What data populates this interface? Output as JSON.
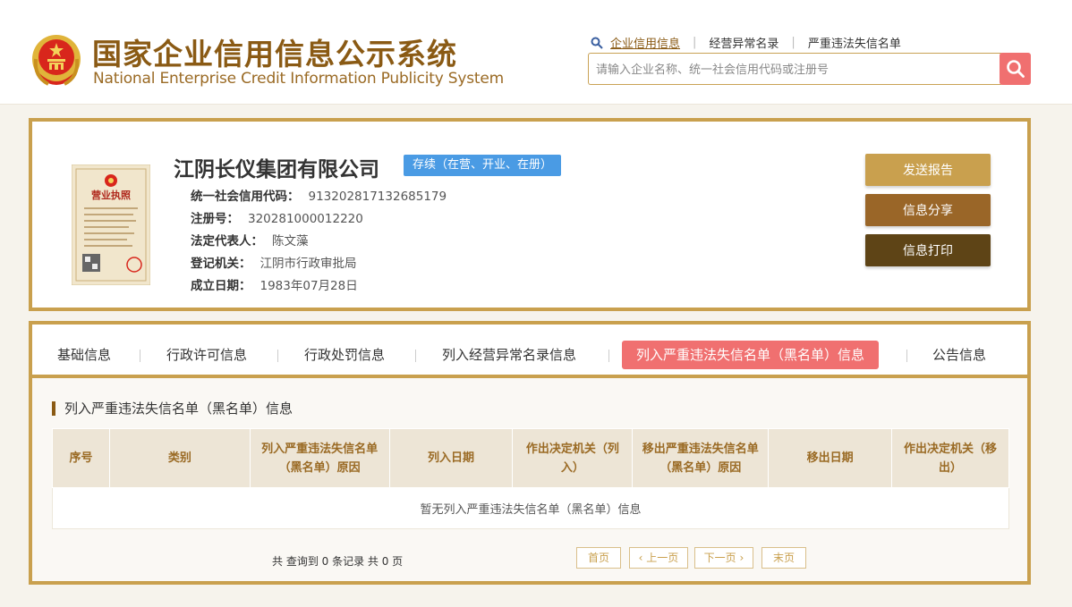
{
  "header": {
    "title_cn": "国家企业信用信息公示系统",
    "title_en": "National Enterprise Credit Information Publicity System",
    "links": [
      "企业信用信息",
      "经营异常名录",
      "严重违法失信名单"
    ],
    "search_placeholder": "请输入企业名称、统一社会信用代码或注册号"
  },
  "company": {
    "name": "江阴长仪集团有限公司",
    "status": "存续（在营、开业、在册）",
    "fields": [
      {
        "label": "统一社会信用代码：",
        "value": "913202817132685179"
      },
      {
        "label": "注册号：",
        "value": "320281000012220"
      },
      {
        "label": "法定代表人：",
        "value": "陈文藻"
      },
      {
        "label": "登记机关：",
        "value": "江阴市行政审批局"
      },
      {
        "label": "成立日期：",
        "value": "1983年07月28日"
      }
    ],
    "licence_label": "营业执照",
    "buttons": {
      "report": "发送报告",
      "share": "信息分享",
      "print": "信息打印"
    }
  },
  "tabs": [
    "基础信息",
    "行政许可信息",
    "行政处罚信息",
    "列入经营异常名录信息",
    "列入严重违法失信名单（黑名单）信息",
    "公告信息"
  ],
  "active_tab": 4,
  "section": {
    "title": "列入严重违法失信名单（黑名单）信息",
    "columns": [
      "序号",
      "类别",
      "列入严重违法失信名单（黑名单）原因",
      "列入日期",
      "作出决定机关（列入）",
      "移出严重违法失信名单（黑名单）原因",
      "移出日期",
      "作出决定机关（移出）"
    ],
    "empty_text": "暂无列入严重违法失信名单（黑名单）信息"
  },
  "pager": {
    "summary": "共 查询到 0 条记录 共 0 页",
    "first": "首页",
    "prev": "上一页",
    "next": "下一页",
    "last": "末页"
  },
  "colors": {
    "gold": "#c9a04e",
    "brown": "#9a6628",
    "dark_brown": "#5e4416",
    "accent_red": "#f07070",
    "badge_blue": "#4a9be4"
  }
}
